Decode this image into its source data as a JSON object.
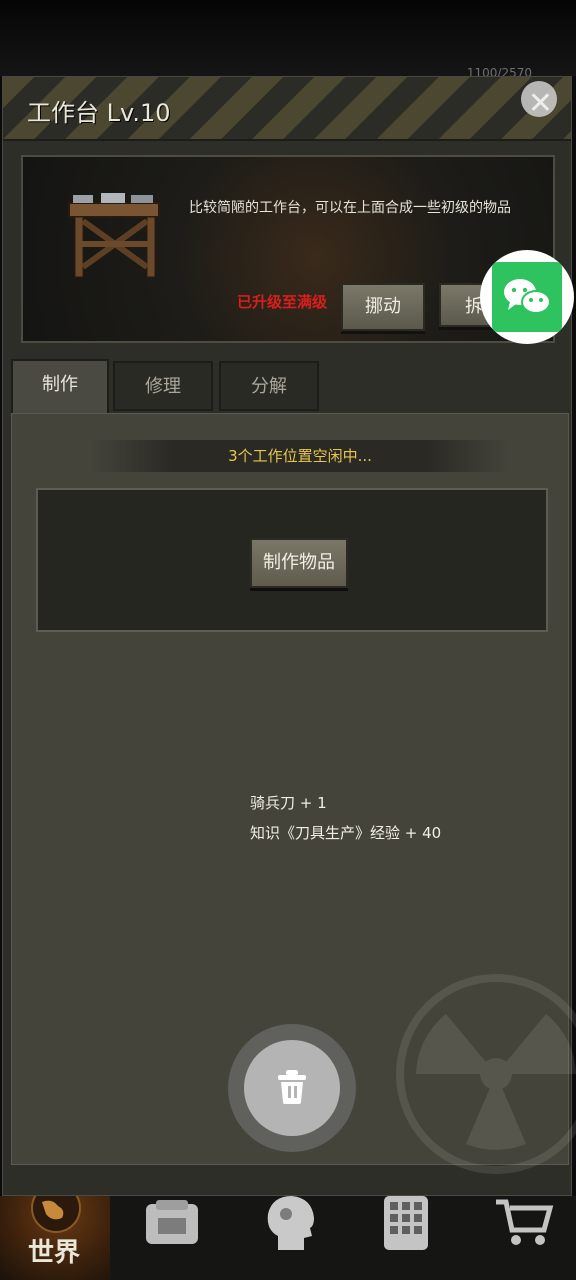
{
  "status_bar": {
    "text": "1100/2570"
  },
  "panel": {
    "title": "工作台 Lv.10",
    "close_icon": "close-icon",
    "description": "比较简陋的工作台，可以在上面合成一些初级的物品",
    "status_maxed": "已升级至满级",
    "move_button": "挪动",
    "dismantle_button": "拆除"
  },
  "floating": {
    "wechat_icon": "wechat-icon"
  },
  "tabs": [
    {
      "label": "制作",
      "active": true
    },
    {
      "label": "修理",
      "active": false
    },
    {
      "label": "分解",
      "active": false
    }
  ],
  "craft": {
    "idle_text": "3个工作位置空闲中...",
    "make_button": "制作物品",
    "rewards": [
      "骑兵刀 + 1",
      "知识《刀具生产》经验 + 40"
    ],
    "trash_icon": "trash-icon"
  },
  "bottom_nav": [
    {
      "label": "世界",
      "icon": "world-icon"
    },
    {
      "label": "",
      "icon": "backpack-icon"
    },
    {
      "label": "",
      "icon": "head-gear-icon"
    },
    {
      "label": "",
      "icon": "phone-icon"
    },
    {
      "label": "",
      "icon": "cart-icon"
    }
  ]
}
